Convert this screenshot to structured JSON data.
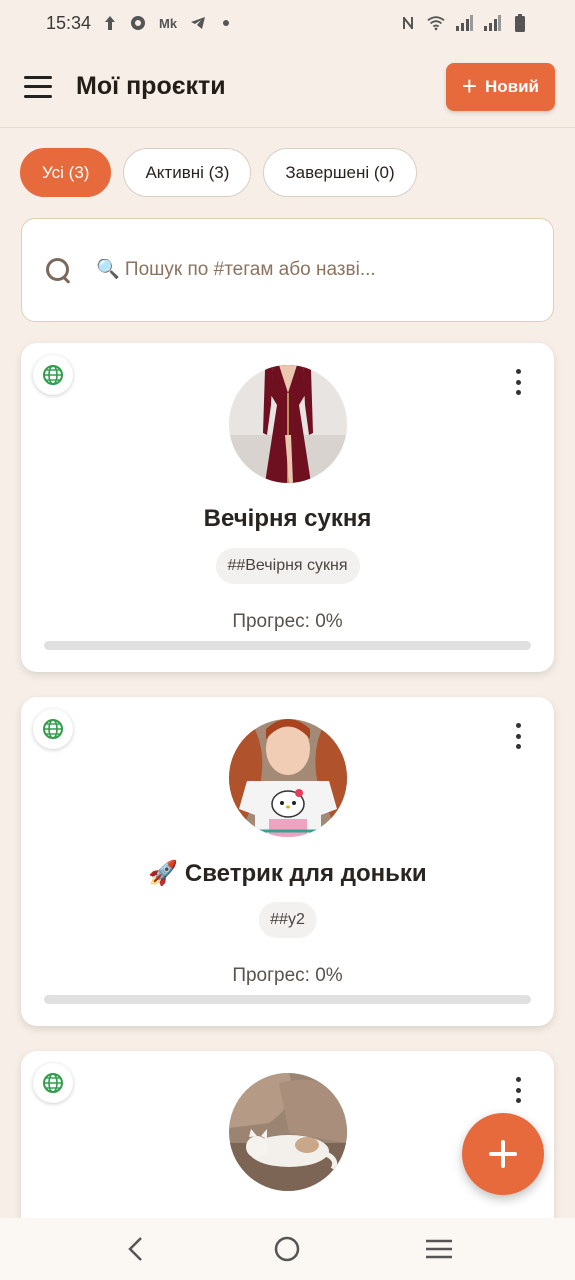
{
  "status_bar": {
    "time": "15:34",
    "icons_left": [
      "upload-arrow-icon",
      "vpn-key-icon",
      "record-icon",
      "mk-app-icon",
      "telegram-icon",
      "dot-icon"
    ],
    "icons_right": [
      "nfc-icon",
      "wifi-icon",
      "signal-icon",
      "signal-icon",
      "battery-icon"
    ],
    "mk_label": "Mk"
  },
  "header": {
    "title": "Мої проєкти",
    "new_button_label": "Новий"
  },
  "filters": [
    {
      "label": "Усі (3)",
      "active": true
    },
    {
      "label": "Активні (3)",
      "active": false
    },
    {
      "label": "Завершені (0)",
      "active": false
    }
  ],
  "search": {
    "placeholder": "🔍 Пошук по #тегам або назві..."
  },
  "projects": [
    {
      "title": "Вечірня сукня",
      "tag": "##Вечірня сукня",
      "progress_label": "Прогрес: 0%",
      "progress": 0,
      "thumb": "dress-photo"
    },
    {
      "title": "🚀 Светрик для доньки",
      "tag": "##у2",
      "progress_label": "Прогрес: 0%",
      "progress": 0,
      "thumb": "girl-sweater-photo"
    },
    {
      "title": "",
      "tag": "",
      "progress_label": "",
      "progress": 0,
      "thumb": "cat-photo"
    }
  ],
  "colors": {
    "accent": "#e76a3c",
    "background": "#f7efe7",
    "globe": "#2e9e4a"
  }
}
